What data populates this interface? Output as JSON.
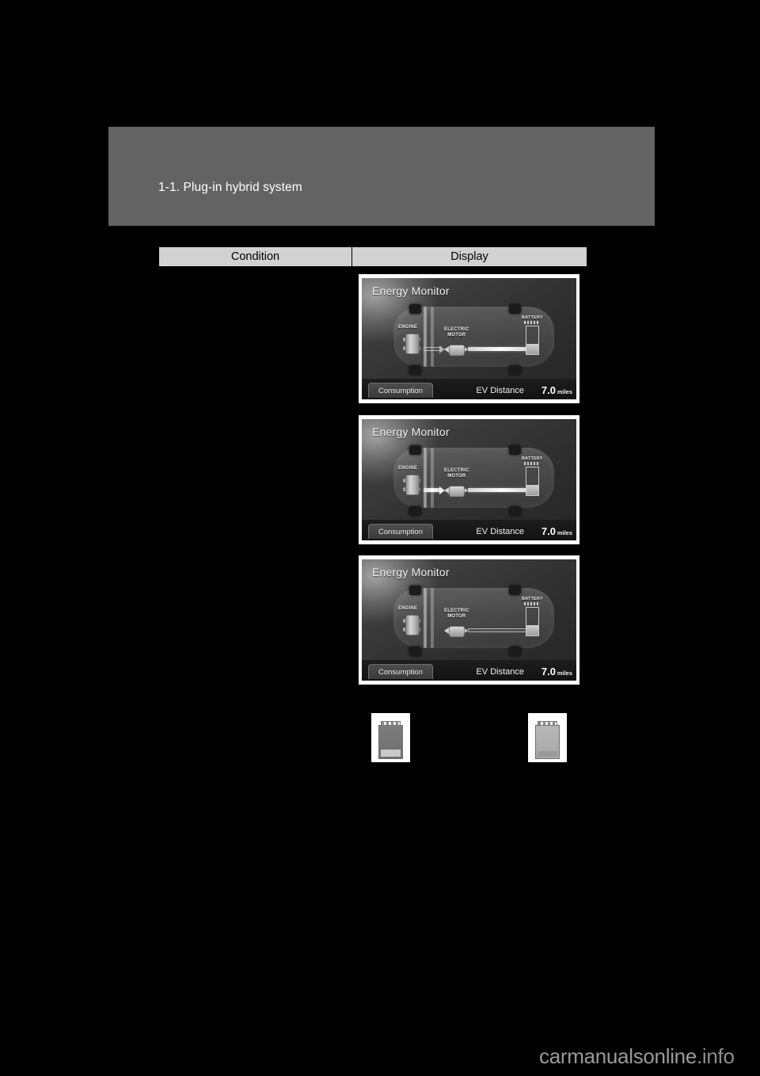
{
  "page": {
    "background_color": "#000000",
    "header_band_color": "#636363",
    "section_title": "1-1. Plug-in hybrid system"
  },
  "table": {
    "header_bg": "#d2d2d2",
    "columns": [
      {
        "key": "condition",
        "label": "Condition"
      },
      {
        "key": "display",
        "label": "Display"
      }
    ],
    "condition_cells": [
      "",
      "",
      ""
    ]
  },
  "energy_monitor_panels": [
    {
      "title": "Energy Monitor",
      "engine_label": "ENGINE",
      "motor_label_line1": "ELECTRIC",
      "motor_label_line2": "MOTOR",
      "battery_label": "BATTERY",
      "consumption_button": "Consumption",
      "ev_distance_label": "EV Distance",
      "ev_distance_value": "7.0",
      "ev_distance_unit": "miles",
      "battery_charge_percent": 36,
      "flow_engine_to_motor": false,
      "flow_motor_to_battery": true
    },
    {
      "title": "Energy Monitor",
      "engine_label": "ENGINE",
      "motor_label_line1": "ELECTRIC",
      "motor_label_line2": "MOTOR",
      "battery_label": "BATTERY",
      "consumption_button": "Consumption",
      "ev_distance_label": "EV Distance",
      "ev_distance_value": "7.0",
      "ev_distance_unit": "miles",
      "battery_charge_percent": 36,
      "flow_engine_to_motor": true,
      "flow_motor_to_battery": true
    },
    {
      "title": "Energy Monitor",
      "engine_label": "ENGINE",
      "motor_label_line1": "ELECTRIC",
      "motor_label_line2": "MOTOR",
      "battery_label": "BATTERY",
      "consumption_button": "Consumption",
      "ev_distance_label": "EV Distance",
      "ev_distance_value": "7.0",
      "ev_distance_unit": "miles",
      "battery_charge_percent": 36,
      "flow_engine_to_motor": false,
      "flow_motor_to_battery": false
    }
  ],
  "battery_icons": [
    {
      "name": "battery-icon-depleted",
      "shade": "dark",
      "level": "low"
    },
    {
      "name": "battery-icon-charged",
      "shade": "light",
      "level": "mid"
    }
  ],
  "watermark": {
    "text": "carmanualsonline",
    "suffix": ".info"
  }
}
